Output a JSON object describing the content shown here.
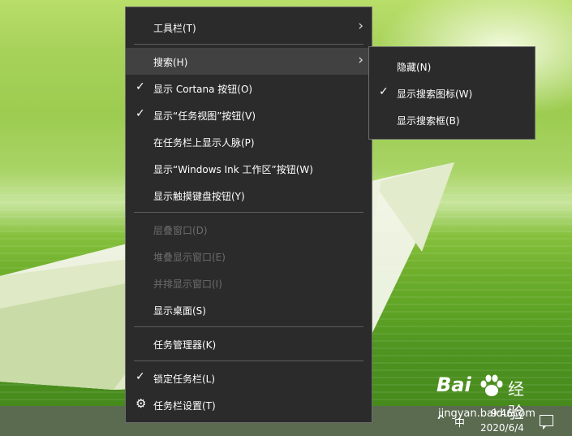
{
  "context_menu": {
    "items": [
      {
        "label": "工具栏(T)",
        "has_submenu": true
      },
      {
        "label": "搜索(H)",
        "has_submenu": true,
        "highlighted": true
      },
      {
        "label": "显示 Cortana 按钮(O)",
        "checked": true
      },
      {
        "label": "显示“任务视图”按钮(V)",
        "checked": true
      },
      {
        "label": "在任务栏上显示人脉(P)"
      },
      {
        "label": "显示“Windows Ink 工作区”按钮(W)"
      },
      {
        "label": "显示触摸键盘按钮(Y)"
      },
      {
        "label": "层叠窗口(D)",
        "disabled": true
      },
      {
        "label": "堆叠显示窗口(E)",
        "disabled": true
      },
      {
        "label": "并排显示窗口(I)",
        "disabled": true
      },
      {
        "label": "显示桌面(S)"
      },
      {
        "label": "任务管理器(K)"
      },
      {
        "label": "锁定任务栏(L)",
        "checked": true
      },
      {
        "label": "任务栏设置(T)",
        "icon": "gear-icon"
      }
    ]
  },
  "search_submenu": {
    "items": [
      {
        "label": "隐藏(N)"
      },
      {
        "label": "显示搜索图标(W)",
        "checked": true
      },
      {
        "label": "显示搜索框(B)"
      }
    ]
  },
  "taskbar": {
    "tray_chevron": "^",
    "ime_indicator": "中",
    "time": "9:46",
    "date": "2020/6/4"
  },
  "watermark": {
    "brand_left": "Bai",
    "brand_right": "经验",
    "url": "jingyan.baidu.com"
  },
  "colors": {
    "menu_bg": "#2b2b2b",
    "menu_hover": "#414141",
    "menu_border": "#6e6e6e",
    "disabled_text": "#6d6d6d"
  }
}
